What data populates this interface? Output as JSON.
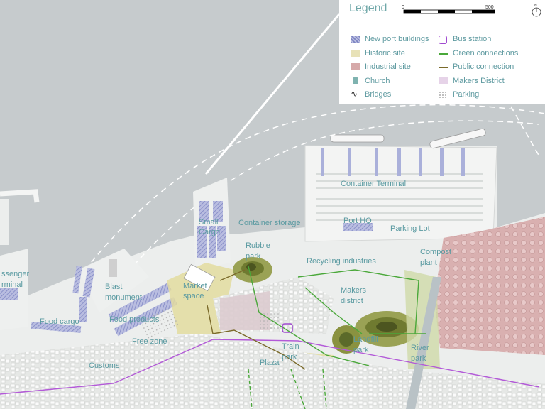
{
  "legend": {
    "title": "Legend",
    "scale_start": "0",
    "scale_end": "500",
    "north": "N",
    "items": [
      {
        "label": "New port buildings",
        "icon": "hatched-rect-icon",
        "color": "#9aa0cf"
      },
      {
        "label": "Historic site",
        "icon": "historic-swatch-icon",
        "color": "#e8e2b8"
      },
      {
        "label": "Industrial site",
        "icon": "industrial-swatch-icon",
        "color": "#d6a9a9"
      },
      {
        "label": "Church",
        "icon": "church-icon",
        "color": "#7fb3b0"
      },
      {
        "label": "Bridges",
        "icon": "bridge-icon",
        "color": "#444444"
      },
      {
        "label": "Bus station",
        "icon": "bus-icon",
        "color": "#a04ad0"
      },
      {
        "label": "Green connections",
        "icon": "green-line-icon",
        "color": "#4aa83a"
      },
      {
        "label": "Public connection",
        "icon": "public-line-icon",
        "color": "#7a6a2a"
      },
      {
        "label": "Makers District",
        "icon": "makers-swatch-icon",
        "color": "#e6d3e8"
      },
      {
        "label": "Parking",
        "icon": "parking-dots-icon",
        "color": "#cccccc"
      }
    ]
  },
  "labels": {
    "container_terminal": "Container Terminal",
    "port_hq": "Port HQ",
    "parking_lot": "Parking Lot",
    "compost_plant_1": "Compost",
    "compost_plant_2": "plant",
    "container_storage": "Container storage",
    "small_cargo_1": "Small",
    "small_cargo_2": "Cargo",
    "rubble_park_1": "Rubble",
    "rubble_park_2": "park",
    "recycling_industries": "Recycling industries",
    "makers_district_1": "Makers",
    "makers_district_2": "district",
    "passenger_terminal_1": "ssenger",
    "passenger_terminal_2": "rminal",
    "blast_monument_1": "Blast",
    "blast_monument_2": "monument",
    "market_space_1": "Market",
    "market_space_2": "space",
    "food_cargo": "Food cargo",
    "food_products": "Food products",
    "free_zone": "Free zone",
    "customs": "Customs",
    "train_park_1": "Train",
    "train_park_2": "park",
    "plaza": "Plaza",
    "landfill_park_1": "Landfill",
    "landfill_park_2": "park",
    "river_park_1": "River",
    "river_park_2": "park"
  },
  "colors": {
    "water": "#c7ccce",
    "land": "#eceeed",
    "historic": "#e5dfa6",
    "industrial": "#d8aaaa",
    "new_building": "#9aa0cf",
    "green_line": "#4aa83a",
    "public_line": "#7a6a2a",
    "bus_route": "#b35ad8",
    "makers": "#e6d3e8",
    "park_dark": "#5b6a2a"
  }
}
